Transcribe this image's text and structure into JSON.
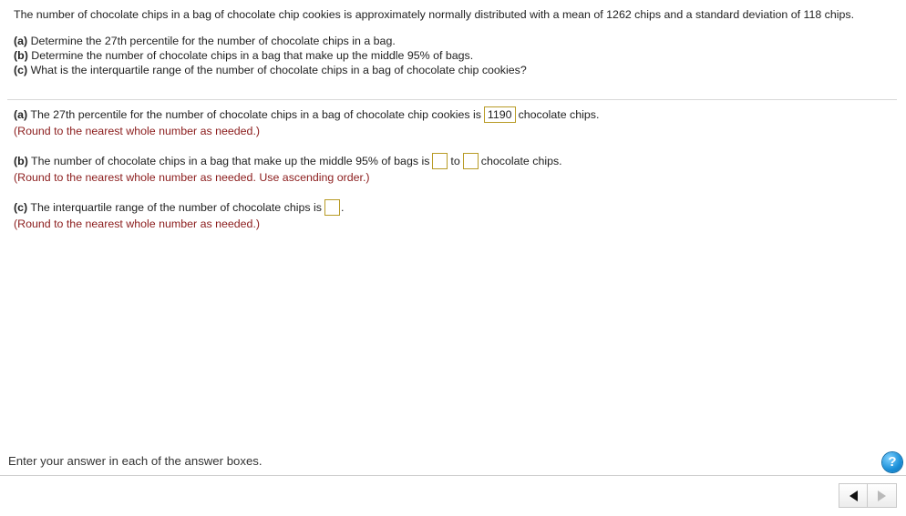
{
  "problem": {
    "intro": "The number of chocolate chips in a bag of chocolate chip cookies is approximately normally distributed with a mean of 1262 chips and a standard deviation of 118 chips.",
    "parts": [
      {
        "label": "(a)",
        "text": " Determine the 27th percentile for the number of chocolate chips in a bag."
      },
      {
        "label": "(b)",
        "text": " Determine the number of chocolate chips in a bag that make up the middle 95% of bags."
      },
      {
        "label": "(c)",
        "text": " What is the interquartile range of the number of chocolate chips in a bag of chocolate chip cookies?"
      }
    ]
  },
  "answers": {
    "a": {
      "label": "(a)",
      "text_before": " The 27th percentile for the number of chocolate chips in a bag of chocolate chip cookies is",
      "value": "1190",
      "text_after": "chocolate chips.",
      "hint": "(Round to the nearest whole number as needed.)"
    },
    "b": {
      "label": "(b)",
      "text_before": " The number of chocolate chips in a bag that make up the middle 95% of bags is",
      "value_low": "",
      "connector": "to",
      "value_high": "",
      "text_after": "chocolate chips.",
      "hint": "(Round to the nearest whole number as needed. Use ascending order.)"
    },
    "c": {
      "label": "(c)",
      "text_before": " The interquartile range of the number of chocolate chips is",
      "value": "",
      "text_after": ".",
      "hint": "(Round to the nearest whole number as needed.)"
    }
  },
  "footer": {
    "instruction": "Enter your answer in each of the answer boxes.",
    "help_label": "?",
    "help_icon": "help-icon",
    "prev_icon": "arrow-left-icon",
    "next_icon": "arrow-right-icon"
  }
}
